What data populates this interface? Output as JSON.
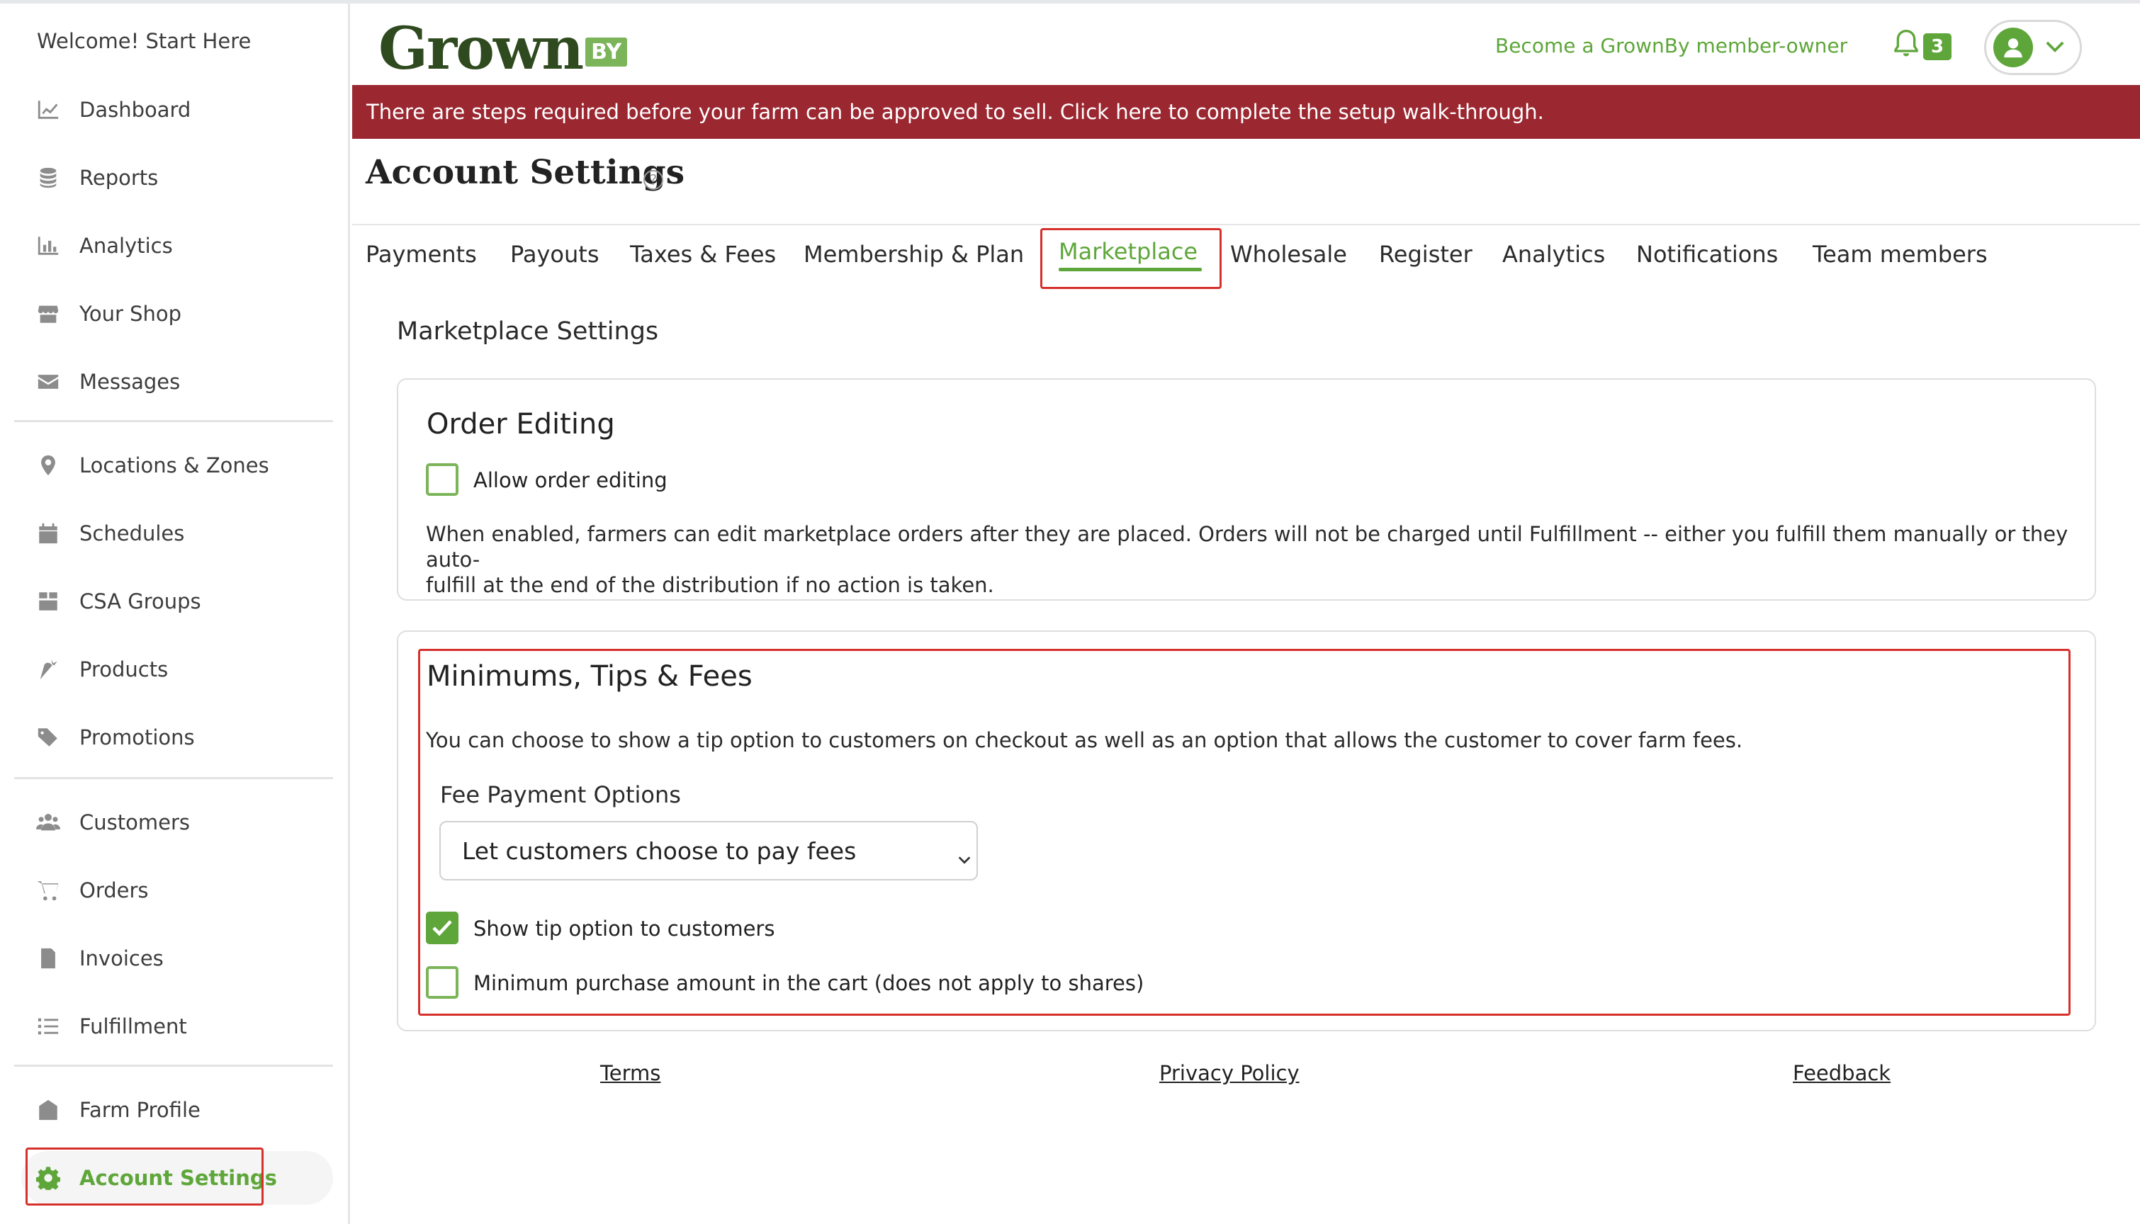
{
  "sidebar": {
    "welcome": "Welcome! Start Here",
    "items": [
      {
        "label": "Dashboard",
        "icon": "chart-line-icon"
      },
      {
        "label": "Reports",
        "icon": "coins-icon"
      },
      {
        "label": "Analytics",
        "icon": "bar-chart-icon"
      },
      {
        "label": "Your Shop",
        "icon": "store-icon"
      },
      {
        "label": "Messages",
        "icon": "envelope-icon"
      },
      {
        "label": "Locations & Zones",
        "icon": "map-pin-icon"
      },
      {
        "label": "Schedules",
        "icon": "calendar-icon"
      },
      {
        "label": "CSA Groups",
        "icon": "box-icon"
      },
      {
        "label": "Products",
        "icon": "carrot-icon"
      },
      {
        "label": "Promotions",
        "icon": "tags-icon"
      },
      {
        "label": "Customers",
        "icon": "users-icon"
      },
      {
        "label": "Orders",
        "icon": "cart-icon"
      },
      {
        "label": "Invoices",
        "icon": "invoice-icon"
      },
      {
        "label": "Fulfillment",
        "icon": "list-icon"
      },
      {
        "label": "Farm Profile",
        "icon": "barn-icon"
      },
      {
        "label": "Account Settings",
        "icon": "gear-icon",
        "active": true
      }
    ]
  },
  "header": {
    "logo_main": "Grown",
    "logo_by": "BY",
    "member_link": "Become a GrownBy member-owner",
    "notification_count": "3"
  },
  "alert": {
    "text": "There are steps required before your farm can be approved to sell. Click here to complete the setup walk-through."
  },
  "page": {
    "title": "Account Settings",
    "help_glyph": "?"
  },
  "tabs": [
    {
      "label": "Payments"
    },
    {
      "label": "Payouts"
    },
    {
      "label": "Taxes & Fees"
    },
    {
      "label": "Membership & Plan"
    },
    {
      "label": "Marketplace",
      "active": true
    },
    {
      "label": "Wholesale"
    },
    {
      "label": "Register"
    },
    {
      "label": "Analytics"
    },
    {
      "label": "Notifications"
    },
    {
      "label": "Team members"
    }
  ],
  "marketplace": {
    "section_title": "Marketplace Settings",
    "order_editing": {
      "title": "Order Editing",
      "checkbox_label": "Allow order editing",
      "checked": false,
      "description_line1": "When enabled, farmers can edit marketplace orders after they are placed. Orders will not be charged until Fulfillment -- either you fulfill them manually or they auto-",
      "description_line2": "fulfill at the end of the distribution if no action is taken."
    },
    "fees": {
      "title": "Minimums, Tips & Fees",
      "description": "You can choose to show a tip option to customers on checkout as well as an option that allows the customer to cover farm fees.",
      "fee_label": "Fee Payment Options",
      "fee_selected": "Let customers choose to pay fees",
      "tip_label": "Show tip option to customers",
      "tip_checked": true,
      "minimum_label": "Minimum purchase amount in the cart (does not apply to shares)",
      "minimum_checked": false
    }
  },
  "footer": {
    "terms": "Terms",
    "privacy": "Privacy Policy",
    "feedback": "Feedback"
  },
  "colors": {
    "brand_green": "#5ea63a",
    "alert_red": "#9b2731",
    "highlight_red": "#d6302b",
    "logo_dark_green": "#2f4a1f"
  }
}
